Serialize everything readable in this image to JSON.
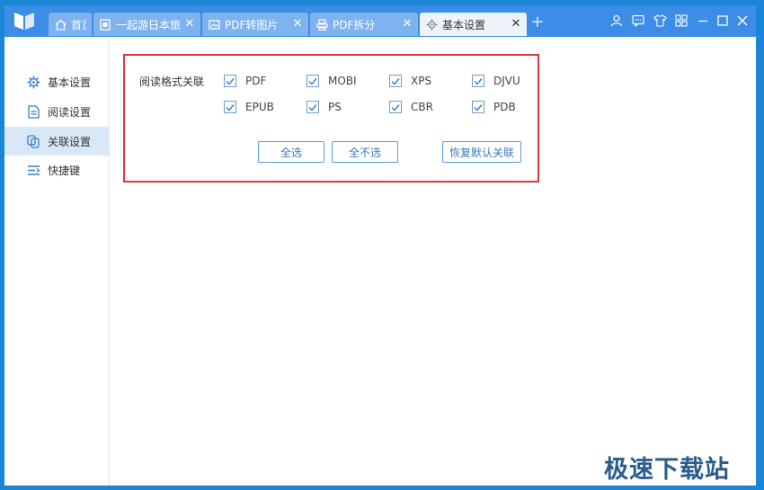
{
  "tabs": [
    {
      "label": "首页",
      "icon": "home-icon",
      "closable": false
    },
    {
      "label": "一起游日本旅游",
      "icon": "document-icon",
      "closable": true
    },
    {
      "label": "PDF转图片",
      "icon": "image-convert-icon",
      "closable": true
    },
    {
      "label": "PDF拆分",
      "icon": "split-icon",
      "closable": true
    },
    {
      "label": "基本设置",
      "icon": "gear-icon",
      "closable": true,
      "active": true
    }
  ],
  "tab_close_glyph": "✕",
  "new_tab_glyph": "+",
  "window_controls": [
    "user-icon",
    "message-icon",
    "skin-icon",
    "apps-icon",
    "minimize-icon",
    "maximize-icon",
    "close-icon"
  ],
  "sidebar": {
    "items": [
      {
        "label": "基本设置",
        "icon": "gear-icon"
      },
      {
        "label": "阅读设置",
        "icon": "document-icon"
      },
      {
        "label": "关联设置",
        "icon": "link-icon",
        "active": true
      },
      {
        "label": "快捷键",
        "icon": "shortcut-icon"
      }
    ]
  },
  "association": {
    "label": "阅读格式关联",
    "formats": [
      {
        "label": "PDF",
        "checked": true
      },
      {
        "label": "MOBI",
        "checked": true
      },
      {
        "label": "XPS",
        "checked": true
      },
      {
        "label": "DJVU",
        "checked": true
      },
      {
        "label": "EPUB",
        "checked": true
      },
      {
        "label": "PS",
        "checked": true
      },
      {
        "label": "CBR",
        "checked": true
      },
      {
        "label": "PDB",
        "checked": true
      }
    ],
    "buttons": {
      "select_all": "全选",
      "select_none": "全不选",
      "restore_default": "恢复默认关联"
    }
  },
  "watermark": "极速下载站",
  "colors": {
    "titlebar": "#3c8de6",
    "accent": "#3a7cc2",
    "highlight_border": "#d83a3a",
    "active_nav": "#d9e8f7"
  }
}
